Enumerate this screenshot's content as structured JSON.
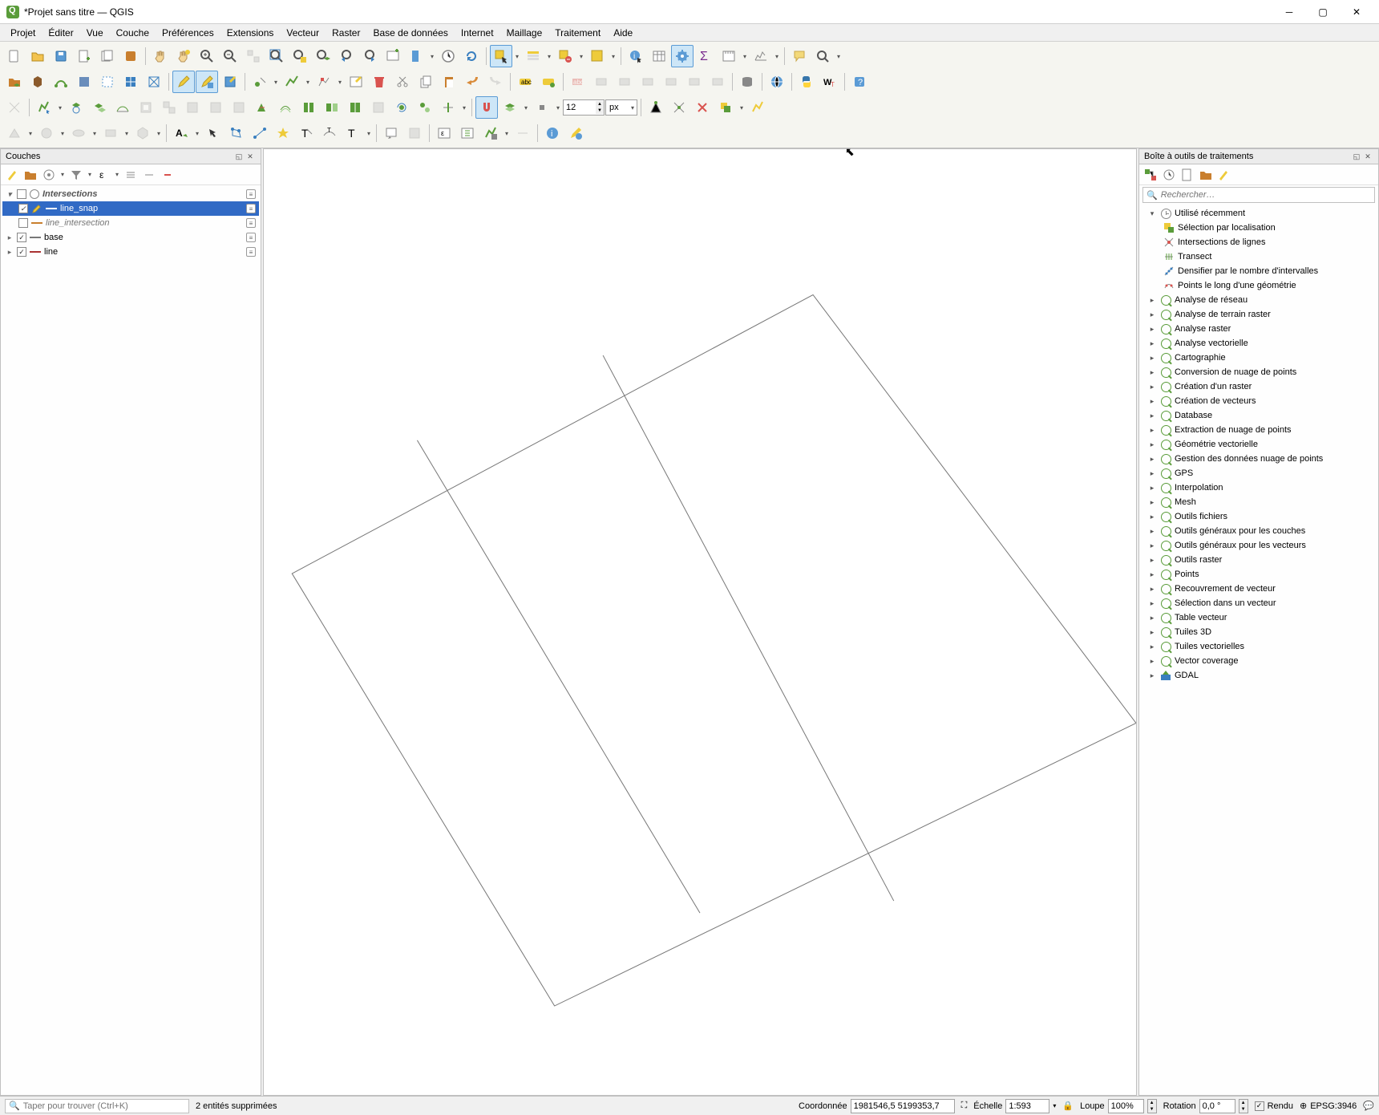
{
  "window": {
    "title": "*Projet sans titre — QGIS"
  },
  "menu": {
    "items": [
      "Projet",
      "Éditer",
      "Vue",
      "Couche",
      "Préférences",
      "Extensions",
      "Vecteur",
      "Raster",
      "Base de données",
      "Internet",
      "Maillage",
      "Traitement",
      "Aide"
    ]
  },
  "snap": {
    "tolerance": "12",
    "unit": "px"
  },
  "layers_panel": {
    "title": "Couches",
    "items": [
      {
        "type": "group",
        "checked": false,
        "name": "Intersections",
        "expanded": true
      },
      {
        "type": "child",
        "checked": true,
        "name": "line_snap",
        "selected": true,
        "color": "#d98b3a"
      },
      {
        "type": "child",
        "checked": false,
        "name": "line_intersection",
        "color": "#c97f2e"
      },
      {
        "type": "layer",
        "checked": true,
        "name": "base",
        "color": "#777"
      },
      {
        "type": "layer",
        "checked": true,
        "name": "line",
        "color": "#a33"
      }
    ]
  },
  "processing_panel": {
    "title": "Boîte à outils de traitements",
    "search_placeholder": "Rechercher…",
    "recent": {
      "label": "Utilisé récemment",
      "items": [
        "Sélection par localisation",
        "Intersections de lignes",
        "Transect",
        "Densifier par le nombre d'intervalles",
        "Points le long d'une géométrie"
      ]
    },
    "groups": [
      "Analyse de réseau",
      "Analyse de terrain raster",
      "Analyse raster",
      "Analyse vectorielle",
      "Cartographie",
      "Conversion de nuage de points",
      "Création d'un raster",
      "Création de vecteurs",
      "Database",
      "Extraction de nuage de points",
      "Géométrie vectorielle",
      "Gestion des données nuage de points",
      "GPS",
      "Interpolation",
      "Mesh",
      "Outils fichiers",
      "Outils généraux pour les couches",
      "Outils généraux pour les vecteurs",
      "Outils raster",
      "Points",
      "Recouvrement de vecteur",
      "Sélection dans un vecteur",
      "Table vecteur",
      "Tuiles 3D",
      "Tuiles vectorielles",
      "Vector coverage",
      "GDAL"
    ]
  },
  "statusbar": {
    "search_placeholder": "Taper pour trouver (Ctrl+K)",
    "message": "2 entités supprimées",
    "coord_label": "Coordonnée",
    "coord_value": "1981546,5 5199353,7",
    "scale_label": "Échelle",
    "scale_value": "1:593",
    "magnifier_label": "Loupe",
    "magnifier_value": "100%",
    "rotation_label": "Rotation",
    "rotation_value": "0,0 °",
    "render_label": "Rendu",
    "crs": "EPSG:3946"
  }
}
